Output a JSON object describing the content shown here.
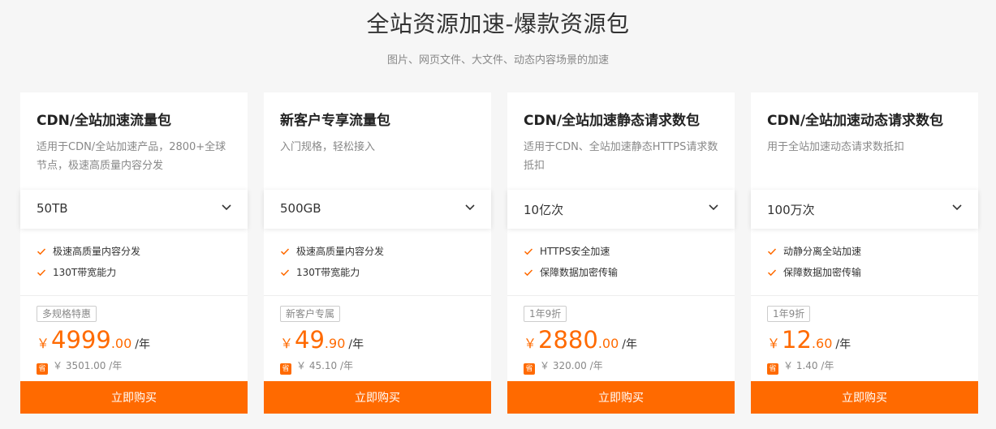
{
  "header": {
    "title": "全站资源加速-爆款资源包",
    "subtitle": "图片、网页文件、大文件、动态内容场景的加速"
  },
  "colors": {
    "accent": "#ff6a00"
  },
  "icons": {
    "select": "chevron-down-icon",
    "feature": "check-icon",
    "saving": "save-icon"
  },
  "cards": [
    {
      "name": "CDN/全站加速流量包",
      "desc": "适用于CDN/全站加速产品，2800+全球节点，极速高质量内容分发",
      "select_value": "50TB",
      "features": [
        "极速高质量内容分发",
        "130T带宽能力"
      ],
      "badge": "多规格特惠",
      "currency": "￥",
      "price_int": "4999",
      "price_dec": ".00",
      "unit": "/年",
      "save_icon_text": "省",
      "orig": "￥ 3501.00 /年",
      "buy_label": "立即购买"
    },
    {
      "name": "新客户专享流量包",
      "desc": "入门规格，轻松接入",
      "select_value": "500GB",
      "features": [
        "极速高质量内容分发",
        "130T带宽能力"
      ],
      "badge": "新客户专属",
      "currency": "￥",
      "price_int": "49",
      "price_dec": ".90",
      "unit": "/年",
      "save_icon_text": "省",
      "orig": "￥ 45.10 /年",
      "buy_label": "立即购买"
    },
    {
      "name": "CDN/全站加速静态请求数包",
      "desc": "适用于CDN、全站加速静态HTTPS请求数抵扣",
      "select_value": "10亿次",
      "features": [
        "HTTPS安全加速",
        "保障数据加密传输"
      ],
      "badge": "1年9折",
      "currency": "￥",
      "price_int": "2880",
      "price_dec": ".00",
      "unit": "/年",
      "save_icon_text": "省",
      "orig": "￥ 320.00 /年",
      "buy_label": "立即购买"
    },
    {
      "name": "CDN/全站加速动态请求数包",
      "desc": "用于全站加速动态请求数抵扣",
      "select_value": "100万次",
      "features": [
        "动静分离全站加速",
        "保障数据加密传输"
      ],
      "badge": "1年9折",
      "currency": "￥",
      "price_int": "12",
      "price_dec": ".60",
      "unit": "/年",
      "save_icon_text": "省",
      "orig": "￥ 1.40 /年",
      "buy_label": "立即购买"
    }
  ]
}
